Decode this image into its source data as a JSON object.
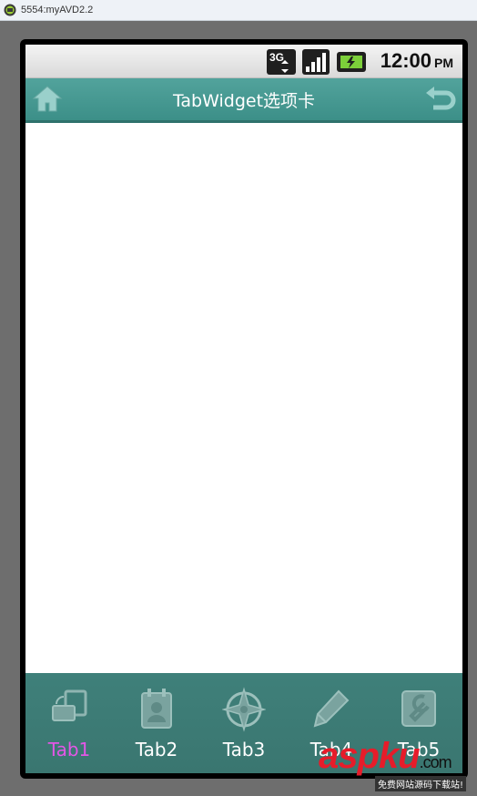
{
  "window": {
    "title": "5554:myAVD2.2"
  },
  "status_bar": {
    "network": "3G",
    "time": "12:00",
    "ampm": "PM"
  },
  "app_bar": {
    "title": "TabWidget选项卡"
  },
  "tabs": [
    {
      "label": "Tab1",
      "icon": "window-icon",
      "active": true
    },
    {
      "label": "Tab2",
      "icon": "contact-icon",
      "active": false
    },
    {
      "label": "Tab3",
      "icon": "compass-icon",
      "active": false
    },
    {
      "label": "Tab4",
      "icon": "pencil-icon",
      "active": false
    },
    {
      "label": "Tab5",
      "icon": "wrench-icon",
      "active": false
    }
  ],
  "watermark": {
    "brand": "aspku",
    "suffix": ".com",
    "tagline": "免费网站源码下载站!"
  },
  "colors": {
    "accent": "#469b94",
    "tabbar": "#3c7a74",
    "active_tab_label": "#e356e6"
  }
}
